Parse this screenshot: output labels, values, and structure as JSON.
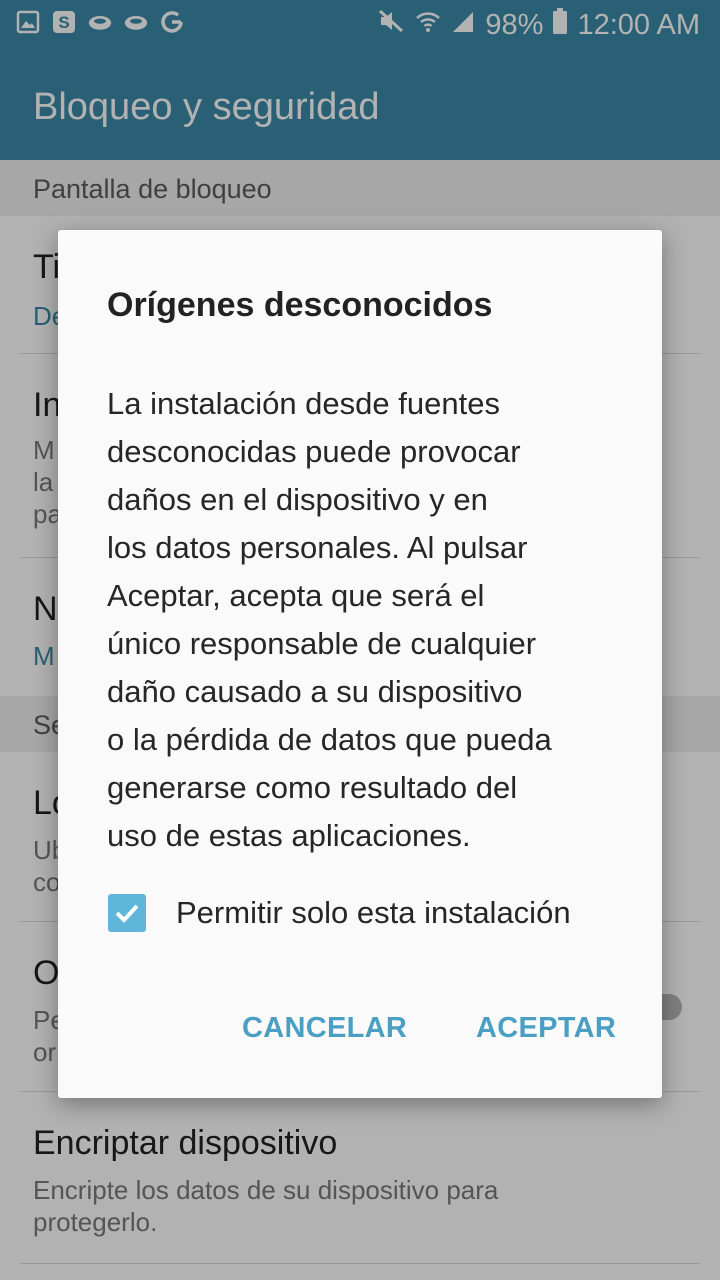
{
  "status_bar": {
    "battery_percent": "98%",
    "time": "12:00 AM",
    "left_icons": [
      "gallery-icon",
      "s-icon",
      "cloud-icon",
      "cloud-icon",
      "google-icon"
    ],
    "right_icons": [
      "mute-icon",
      "wifi-icon",
      "signal-icon",
      "battery-icon"
    ]
  },
  "app_bar": {
    "title": "Bloqueo y seguridad",
    "color": "#3c8aa8"
  },
  "settings": {
    "section1_header": "Pantalla de bloqueo",
    "row1": {
      "title": "Ti",
      "sub": "De"
    },
    "row2": {
      "title": "In",
      "sub_lines": [
        "M",
        "la",
        "pa"
      ]
    },
    "row3": {
      "title": "N",
      "sub": "M"
    },
    "section2_header": "Se",
    "row4": {
      "title": "Lo",
      "sub_lines": [
        "Ub",
        "co"
      ]
    },
    "row5": {
      "title": "O",
      "sub_lines": [
        "Pe",
        "or"
      ]
    },
    "row6": {
      "title": "Encriptar dispositivo",
      "sub_lines": [
        "Encripte los datos de su dispositivo para",
        "protegerlo."
      ]
    }
  },
  "dialog": {
    "title": "Orígenes desconocidos",
    "body_lines": [
      "La instalación desde fuentes",
      "desconocidas puede provocar",
      "daños en el dispositivo y en",
      "los datos personales. Al pulsar",
      "Aceptar, acepta que será el",
      "único responsable de cualquier",
      "daño causado a su dispositivo",
      "o la pérdida de datos que pueda",
      "generarse como resultado del",
      "uso de estas aplicaciones."
    ],
    "checkbox_label": "Permitir solo esta instalación",
    "checkbox_checked": true,
    "cancel_label": "CANCELAR",
    "accept_label": "ACEPTAR",
    "accent_color": "#4a9fc3"
  }
}
